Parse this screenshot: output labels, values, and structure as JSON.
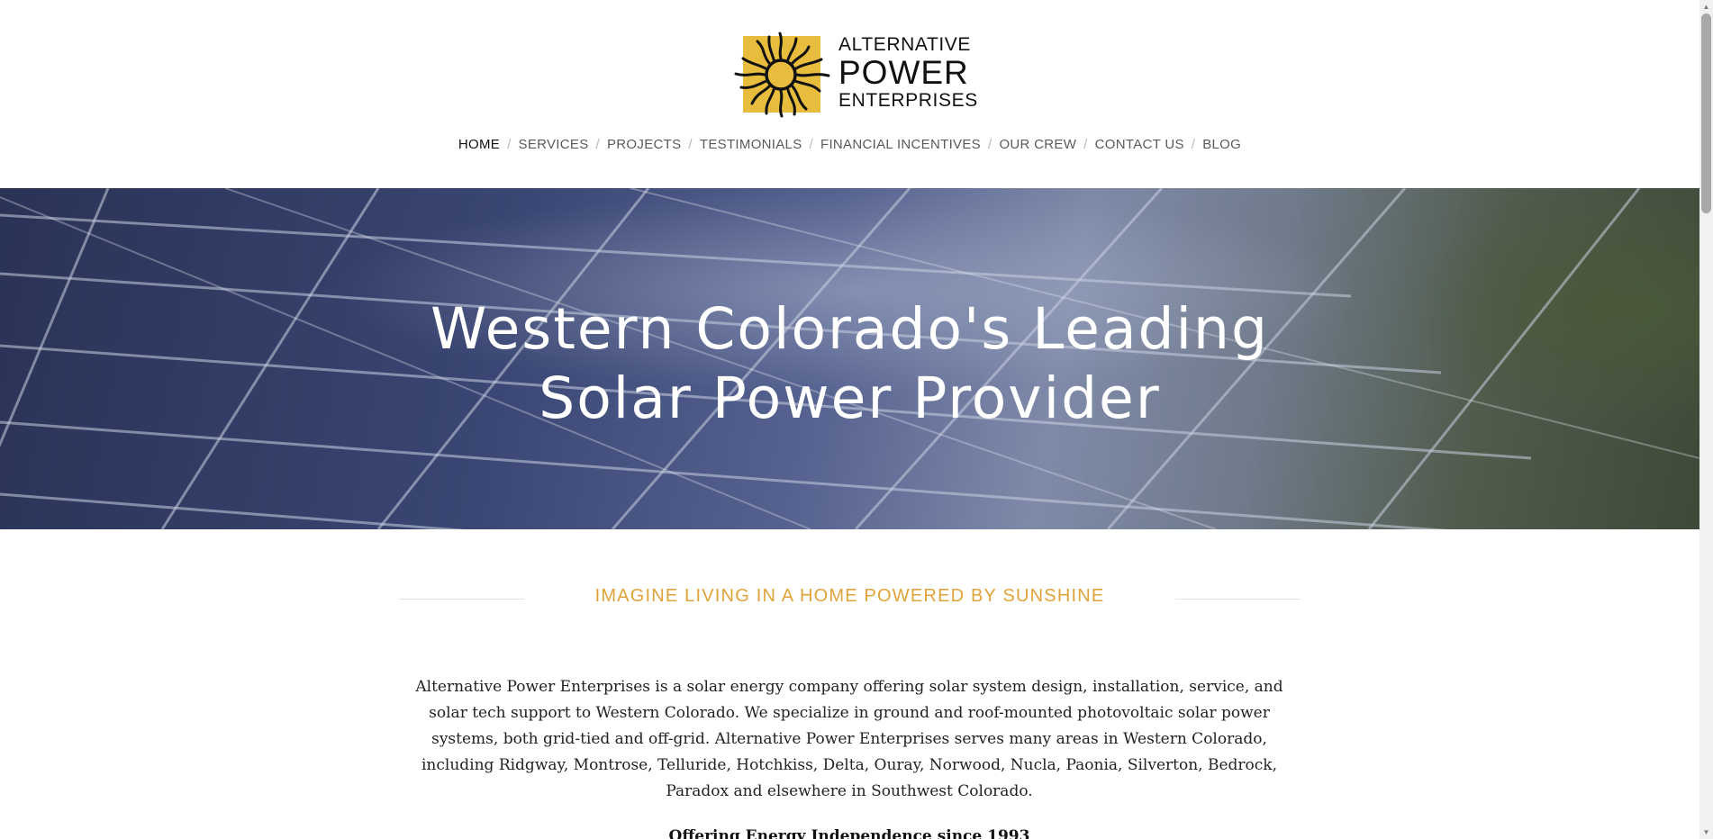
{
  "logo": {
    "line1": "ALTERNATIVE",
    "line2": "POWER",
    "line3": "ENTERPRISES",
    "icon": "sun-logo-icon",
    "accent_color": "#e8bd3d"
  },
  "nav": {
    "items": [
      {
        "label": "HOME",
        "active": true
      },
      {
        "label": "SERVICES"
      },
      {
        "label": "PROJECTS"
      },
      {
        "label": "TESTIMONIALS"
      },
      {
        "label": "FINANCIAL INCENTIVES"
      },
      {
        "label": "OUR CREW"
      },
      {
        "label": "CONTACT US"
      },
      {
        "label": "BLOG"
      }
    ],
    "separator": "/"
  },
  "hero": {
    "title_line1": "Western Colorado's Leading",
    "title_line2": "Solar Power Provider"
  },
  "section": {
    "heading": "IMAGINE LIVING IN A HOME POWERED BY SUNSHINE",
    "heading_color": "#e0a33a",
    "intro": "Alternative Power Enterprises is a solar energy company offering solar system design, installation, service, and solar tech support to Western Colorado. We specialize in ground and roof-mounted photovoltaic solar power systems, both grid-tied and off-grid. Alternative Power Enterprises serves many areas in Western Colorado, including Ridgway, Montrose, Telluride, Hotchkiss, Delta, Ouray, Norwood, Nucla, Paonia, Silverton, Bedrock, Paradox and elsewhere in Southwest Colorado.",
    "since": "Offering Energy Independence since 1993"
  }
}
